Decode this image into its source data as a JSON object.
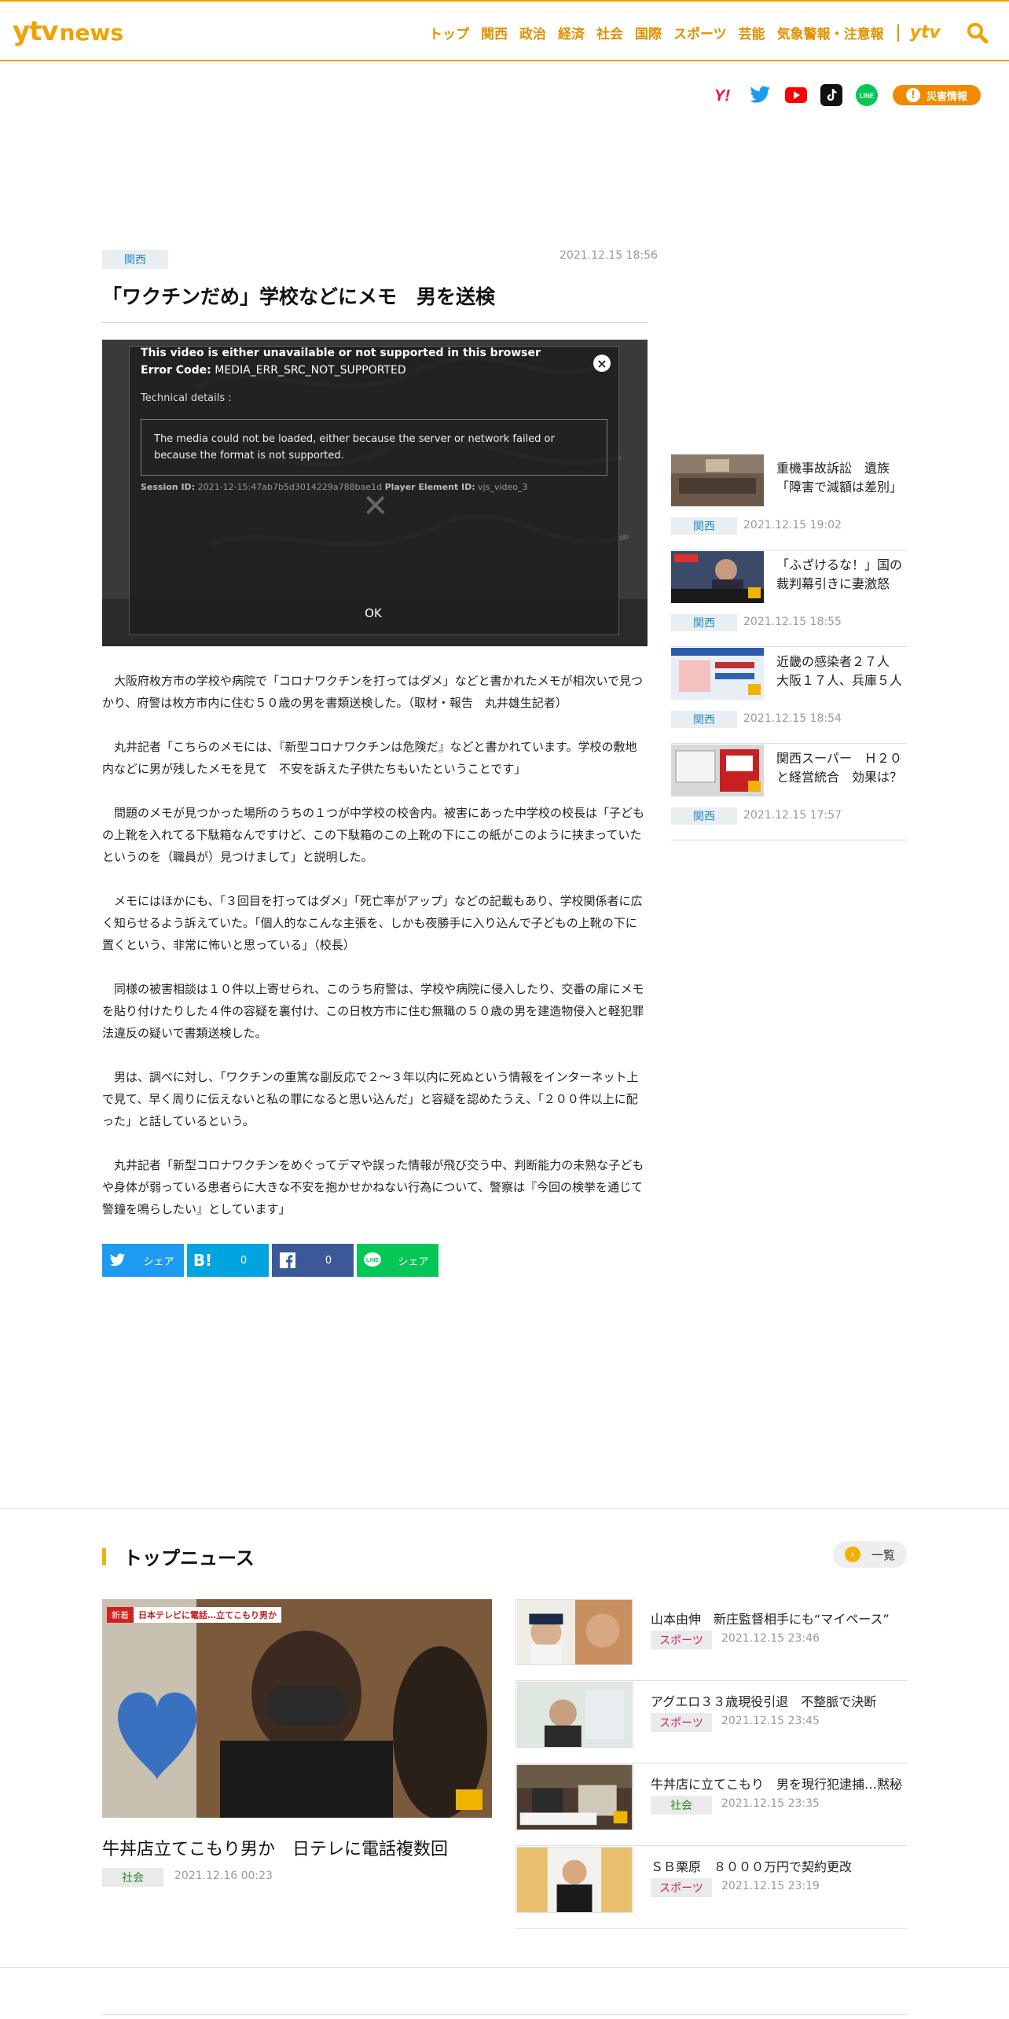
{
  "header": {
    "logo_ytv": "ytv",
    "logo_news": "news",
    "nav": [
      "トップ",
      "関西",
      "政治",
      "経済",
      "社会",
      "国際",
      "スポーツ",
      "芸能",
      "気象警報・注意報"
    ],
    "ytv_link": "ytv"
  },
  "social": {
    "icons": [
      "yahoo-icon",
      "twitter-icon",
      "youtube-icon",
      "tiktok-icon",
      "line-icon"
    ],
    "disaster_label": "災害情報"
  },
  "article": {
    "tag": "関西",
    "date": "2021.12.15 18:56",
    "title": "「ワクチンだめ」学校などにメモ　男を送検",
    "video": {
      "error_title": "This video is either unavailable or not supported in this browser",
      "error_code_label": "Error Code:",
      "error_code": "MEDIA_ERR_SRC_NOT_SUPPORTED",
      "tech_details": "Technical details :",
      "message": "The media could not be loaded, either because the server or network failed or because the format is not supported.",
      "session_label": "Session ID:",
      "session_id": "2021-12-15:47ab7b5d3014229a788bae1d",
      "player_label": "Player Element ID:",
      "player_id": "vjs_video_3",
      "ok": "OK"
    },
    "paragraphs": [
      "大阪府枚方市の学校や病院で「コロナワクチンを打ってはダメ」などと書かれたメモが相次いで見つかり、府警は枚方市内に住む５０歳の男を書類送検した。（取材・報告　丸井雄生記者）",
      "丸井記者「こちらのメモには、『新型コロナワクチンは危険だ』などと書かれています。学校の敷地内などに男が残したメモを見て　不安を訴えた子供たちもいたということです」",
      "問題のメモが見つかった場所のうちの１つが中学校の校舎内。被害にあった中学校の校長は「子どもの上靴を入れてる下駄箱なんですけど、この下駄箱のこの上靴の下にこの紙がこのように挟まっていたというのを（職員が）見つけまして」と説明した。",
      "メモにはほかにも、「３回目を打ってはダメ」「死亡率がアップ」などの記載もあり、学校関係者に広く知らせるよう訴えていた。「個人的なこんな主張を、しかも夜勝手に入り込んで子どもの上靴の下に置くという、非常に怖いと思っている」（校長）",
      "同様の被害相談は１０件以上寄せられ、このうち府警は、学校や病院に侵入したり、交番の扉にメモを貼り付けたりした４件の容疑を裏付け、この日枚方市に住む無職の５０歳の男を建造物侵入と軽犯罪法違反の疑いで書類送検した。",
      "男は、調べに対し、「ワクチンの重篤な副反応で２～３年以内に死ぬという情報をインターネット上で見て、早く周りに伝えないと私の罪になると思い込んだ」と容疑を認めたうえ、「２００件以上に配った」と話しているという。",
      "丸井記者「新型コロナワクチンをめぐってデマや誤った情報が飛び交う中、判断能力の未熟な子どもや身体が弱っている患者らに大きな不安を抱かせかねない行為について、警察は『今回の検挙を通じて警鐘を鳴らしたい』としています」"
    ],
    "share": {
      "twitter": "シェア",
      "hatena": "0",
      "facebook": "0",
      "line": "シェア"
    }
  },
  "sidebar": [
    {
      "title": "重機事故訴訟　遺族「障害で減額は差別」",
      "tag": "関西",
      "date": "2021.12.15 19:02"
    },
    {
      "title": "「ふざけるな！」国の裁判幕引きに妻激怒",
      "tag": "関西",
      "date": "2021.12.15 18:55"
    },
    {
      "title": "近畿の感染者２７人　大阪１７人、兵庫５人",
      "tag": "関西",
      "date": "2021.12.15 18:54"
    },
    {
      "title": "関西スーパー　Ｈ２０と経営統合　効果は？",
      "tag": "関西",
      "date": "2021.12.15 17:57"
    }
  ],
  "top_news": {
    "heading": "トップニュース",
    "more": "一覧",
    "main": {
      "title": "牛丼店立てこもり男か　日テレに電話複数回",
      "tag": "社会",
      "date": "2021.12.16 00:23",
      "thumb_caption": "日本テレビに電話…立てこもり男か",
      "thumb_badge": "新着"
    },
    "items": [
      {
        "title": "山本由伸　新庄監督相手にも“マイペース”",
        "tag": "スポーツ",
        "date": "2021.12.15 23:46"
      },
      {
        "title": "アグエロ３３歳現役引退　不整脈で決断",
        "tag": "スポーツ",
        "date": "2021.12.15 23:45"
      },
      {
        "title": "牛丼店に立てこもり　男を現行犯逮捕…黙秘",
        "tag": "社会",
        "date": "2021.12.15 23:35"
      },
      {
        "title": "ＳＢ栗原　８０００万円で契約更改",
        "tag": "スポーツ",
        "date": "2021.12.15 23:19"
      }
    ]
  },
  "colors": {
    "brand": "#f0a200",
    "tag_blue": "#2a8bc7",
    "tag_sports": "#cc2266",
    "tag_society": "#2a8a2a"
  }
}
